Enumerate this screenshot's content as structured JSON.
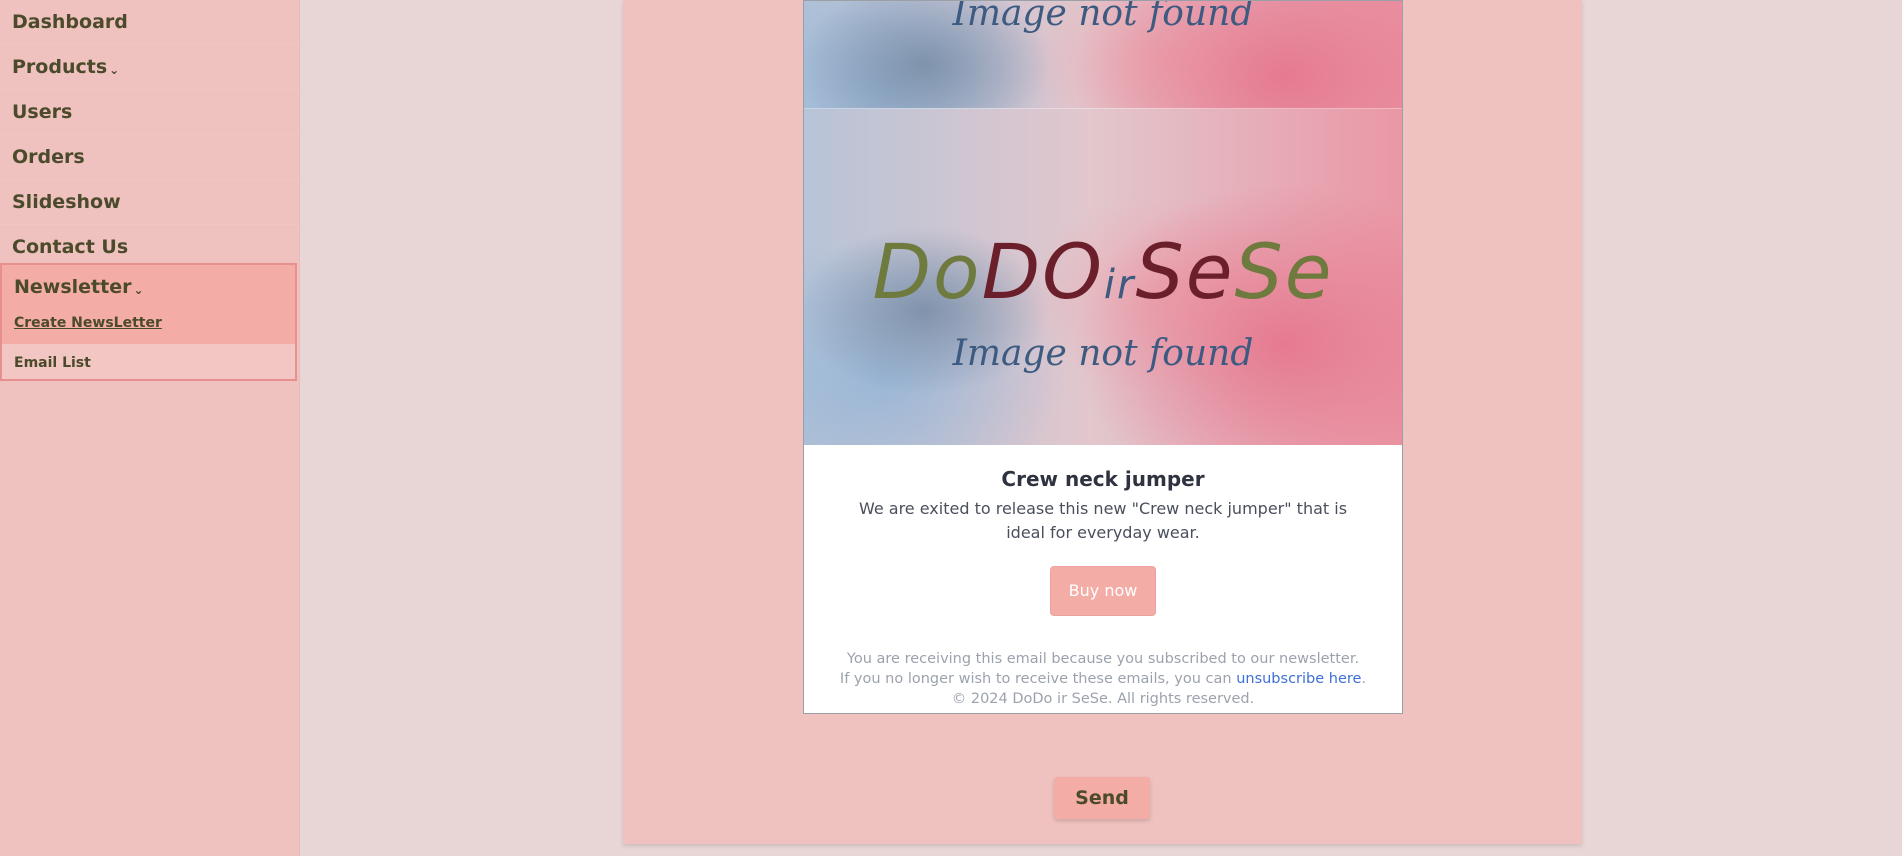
{
  "sidebar": {
    "items": [
      {
        "label": "Dashboard"
      },
      {
        "label": "Products",
        "expandable": true
      },
      {
        "label": "Users"
      },
      {
        "label": "Orders"
      },
      {
        "label": "Slideshow"
      },
      {
        "label": "Contact Us"
      }
    ],
    "newsletter": {
      "label": "Newsletter",
      "chevron": "⌄",
      "sub_items": {
        "create": "Create NewsLetter",
        "email_list": "Email List"
      }
    }
  },
  "email": {
    "hero_top_text": "Image not found",
    "hero_logo": [
      "Do",
      "DO",
      " ir ",
      "Se",
      "Se"
    ],
    "hero_logo_colors": [
      "#6f7a3e",
      "#6b1f2a",
      "#3d5a80",
      "#6b1f2a",
      "#6f7a3e"
    ],
    "hero_bottom_text": "Image not found",
    "product_name": "Crew neck jumper",
    "product_description": "We are exited to release this new \"Crew neck jumper\" that is ideal for everyday wear.",
    "buy_button": "Buy now",
    "footer": {
      "line1": "You are receiving this email because you subscribed to our newsletter.",
      "line2_prefix": "If you no longer wish to receive these emails, you can ",
      "unsubscribe_link": "unsubscribe here",
      "line2_suffix": ".",
      "copyright": "© 2024 DoDo ir SeSe. All rights reserved."
    }
  },
  "actions": {
    "send": "Send"
  },
  "colors": {
    "accent": "#f3aca6",
    "sidebar_bg": "#efc2bf",
    "text_dark": "#4b4a2a",
    "link": "#3f6fd8"
  }
}
